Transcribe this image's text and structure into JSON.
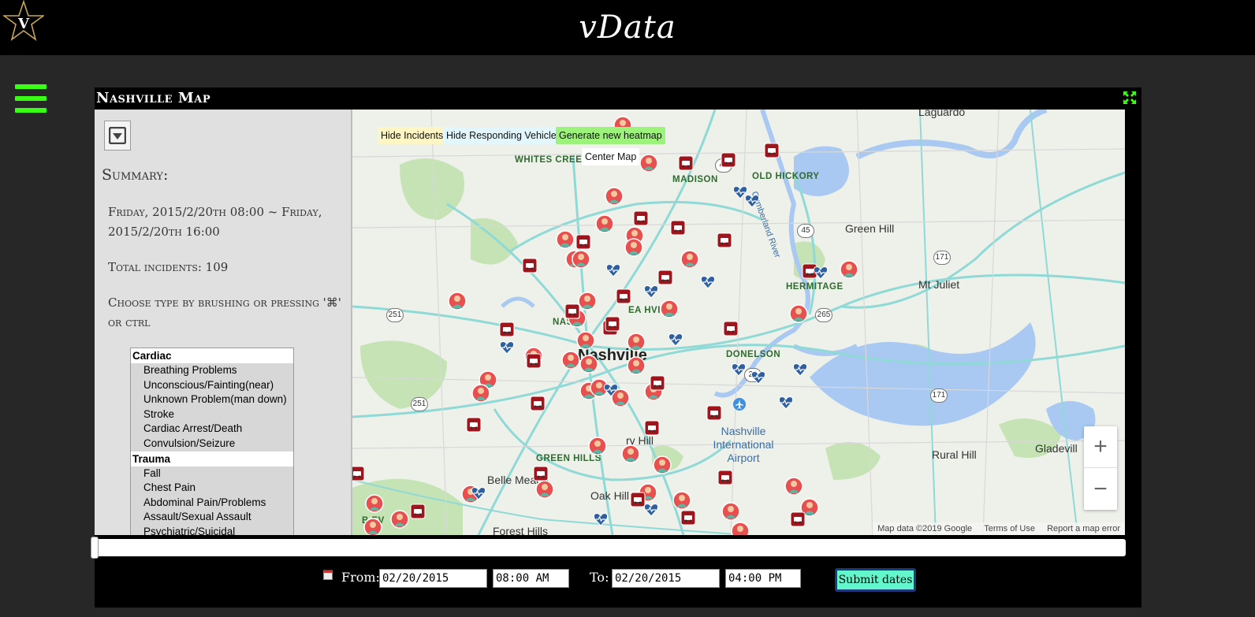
{
  "header": {
    "title": "vData",
    "logo": "V"
  },
  "panel": {
    "title": "Nashville Map"
  },
  "sidebar": {
    "summary_title": "Summary:",
    "date_range": "Friday, 2015/2/20th 08:00 ~ Friday, 2015/2/20th 16:00",
    "total_incidents": "Total incidents: 109",
    "instruction": "Choose type by brushing or pressing '⌘' or ctrl",
    "types": [
      {
        "group": "Cardiac",
        "items": [
          "Breathing Problems",
          "Unconscious/Fainting(near)",
          "Unknown Problem(man down)",
          "Stroke",
          "Cardiac Arrest/Death",
          "Convulsion/Seizure"
        ]
      },
      {
        "group": "Trauma",
        "items": [
          "Fall",
          "Chest Pain",
          "Abdominal Pain/Problems",
          "Assault/Sexual Assault",
          "Psychiatric/Suicidal"
        ]
      }
    ]
  },
  "map": {
    "buttons": {
      "hide_incidents": "Hide Incidents",
      "hide_vehicles": "Hide Responding Vehicles",
      "heatmap": "Generate new heatmap",
      "center": "Center Map"
    },
    "labels": {
      "whites_creek": "WHITES CREEK",
      "madison": "MADISON",
      "old_hickory": "OLD HICKORY",
      "green_hill": "Green Hill",
      "mt_juliet": "Mt Juliet",
      "hermitage": "HERMITAGE",
      "nashville": "Nashville",
      "nas": "NAS",
      "east_nashville": "EA      HVILLE",
      "donelson": "DONELSON",
      "airport": "Nashville International Airport",
      "green_hills": "GREEN HILLS",
      "belle_meade": "Belle Meade",
      "oak_hill": "Oak Hill",
      "forest_hills": "Forest Hills",
      "rural_hill": "Rural Hill",
      "gladeville": "Gladevill",
      "laguardo": "Laguardo",
      "cumberland_river": "Cumberland River",
      "berry_hill": "ry Hill",
      "belle_ev": "B  EV"
    },
    "shields": [
      "45",
      "45",
      "171",
      "251",
      "251",
      "265",
      "171",
      "24"
    ],
    "zoom_in": "+",
    "zoom_out": "−",
    "attribution": {
      "data": "Map data ©2019 Google",
      "terms": "Terms of Use",
      "report": "Report a map error"
    },
    "colors": {
      "incident": "#e8504f",
      "vehicle": "#2e5f9e",
      "ambulance": "#a0141c",
      "road": "#8ed8d8",
      "park": "#b9dba5",
      "water": "#a8c8f0"
    }
  },
  "dates": {
    "from_label": "From:",
    "from_date": "02/20/2015",
    "from_time": "08:00 AM",
    "to_label": "To:",
    "to_date": "02/20/2015",
    "to_time": "04:00 PM",
    "submit": "Submit dates"
  },
  "theme": {
    "accent": "#39ff14",
    "submit_bg": "#63f5cc"
  }
}
